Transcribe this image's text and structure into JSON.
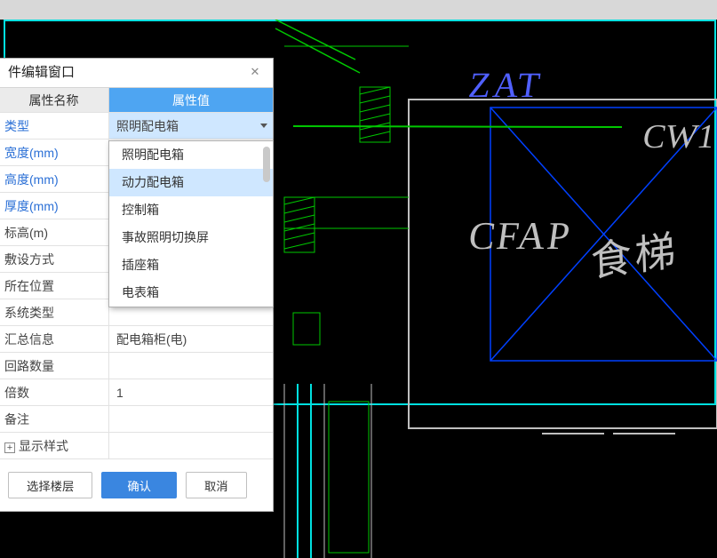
{
  "dialog": {
    "title": "件编辑窗口",
    "header": {
      "name": "属性名称",
      "value": "属性值"
    },
    "rows": [
      {
        "label": "类型",
        "value": "照明配电箱",
        "blue": true,
        "editing": true
      },
      {
        "label": "宽度(mm)",
        "value": "",
        "blue": true
      },
      {
        "label": "高度(mm)",
        "value": "",
        "blue": true
      },
      {
        "label": "厚度(mm)",
        "value": "",
        "blue": true
      },
      {
        "label": "标高(m)",
        "value": "",
        "blue": false
      },
      {
        "label": "敷设方式",
        "value": "",
        "blue": false
      },
      {
        "label": "所在位置",
        "value": "",
        "blue": false
      },
      {
        "label": "系统类型",
        "value": "",
        "blue": false
      },
      {
        "label": "汇总信息",
        "value": "配电箱柜(电)",
        "blue": false
      },
      {
        "label": "回路数量",
        "value": "",
        "blue": false
      },
      {
        "label": "倍数",
        "value": "1",
        "blue": false
      },
      {
        "label": "备注",
        "value": "",
        "blue": false
      },
      {
        "label": "显示样式",
        "value": "",
        "blue": false,
        "expander": true
      }
    ],
    "footer": {
      "select_floor": "选择楼层",
      "ok": "确认",
      "cancel": "取消"
    }
  },
  "dropdown": {
    "options": [
      "照明配电箱",
      "动力配电箱",
      "控制箱",
      "事故照明切换屏",
      "插座箱",
      "电表箱"
    ],
    "hover_index": 1
  },
  "cad": {
    "labels": {
      "zat": "ZAT",
      "cfap": "CFAP",
      "cw1": "CW1",
      "elevator": "食梯"
    },
    "colors": {
      "green": "#00c800",
      "cyan": "#00e0e0",
      "blue": "#0040ff",
      "blue_text": "#5060ff",
      "grey": "#bfbfbf"
    }
  }
}
